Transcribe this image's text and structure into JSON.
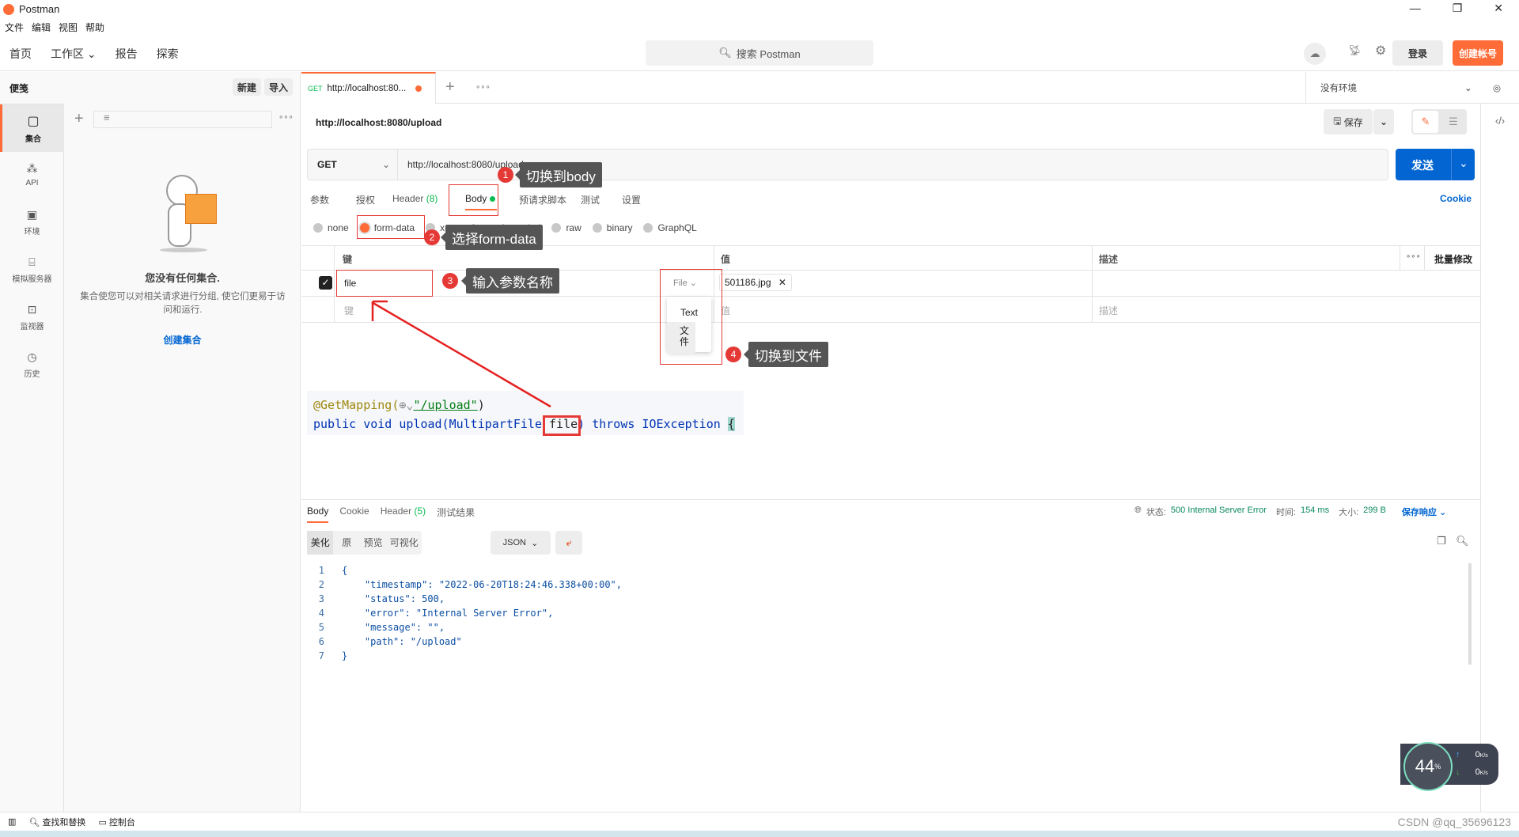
{
  "window": {
    "title": "Postman",
    "menu": [
      "文件",
      "编辑",
      "视图",
      "帮助"
    ]
  },
  "topnav": {
    "items": [
      "首页",
      "工作区",
      "报告",
      "探索"
    ],
    "search_placeholder": "搜索 Postman",
    "login": "登录",
    "signup": "创建帐号",
    "accent": "#ff6c37"
  },
  "sidebar": {
    "title": "便笺",
    "new": "新建",
    "import": "导入",
    "rail": [
      {
        "label": "集合",
        "icon": "collection-icon"
      },
      {
        "label": "API",
        "icon": "api-icon"
      },
      {
        "label": "环境",
        "icon": "environment-icon"
      },
      {
        "label": "模拟服务器",
        "icon": "mock-server-icon"
      },
      {
        "label": "监视器",
        "icon": "monitor-icon"
      },
      {
        "label": "历史",
        "icon": "history-icon"
      }
    ],
    "empty_title": "您没有任何集合.",
    "empty_desc": "集合使您可以对相关请求进行分组, 使它们更易于访问和运行.",
    "create": "创建集合"
  },
  "tab": {
    "method": "GET",
    "label": "http://localhost:80..."
  },
  "environment": "没有环境",
  "request": {
    "name": "http://localhost:8080/upload",
    "save": "保存",
    "method": "GET",
    "url": "http://localhost:8080/upload",
    "send": "发送",
    "cookie": "Cookie",
    "tabs": [
      "参数",
      "授权",
      "Header",
      "Body",
      "预请求脚本",
      "测试",
      "设置"
    ],
    "header_count": "(8)",
    "body_types": [
      "none",
      "form-data",
      "x-www-form-urlencoded",
      "raw",
      "binary",
      "GraphQL"
    ],
    "selected_body_type": "form-data",
    "table": {
      "headers": [
        "键",
        "值",
        "描述",
        "批量修改"
      ],
      "row": {
        "key": "file",
        "type": "File",
        "value": "501186.jpg",
        "checked": true
      },
      "placeholder": {
        "key": "键",
        "value": "值",
        "desc": "描述"
      }
    },
    "type_menu": [
      "Text",
      "文件"
    ]
  },
  "annotations": [
    {
      "n": "1",
      "text": "切换到body"
    },
    {
      "n": "2",
      "text": "选择form-data"
    },
    {
      "n": "3",
      "text": "输入参数名称"
    },
    {
      "n": "4",
      "text": "切换到文件"
    }
  ],
  "code": {
    "line1_a": "@GetMapping(",
    "line1_b": "\"/upload\"",
    "line1_c": ")",
    "line2": [
      "public void upload(MultipartFile ",
      "file",
      ") throws IOException ",
      "{"
    ]
  },
  "response": {
    "tabs": [
      "Body",
      "Cookie",
      "Header",
      "测试结果"
    ],
    "header_count": "(5)",
    "status_label": "状态:",
    "status": "500 Internal Server Error",
    "time_label": "时间:",
    "time": "154 ms",
    "size_label": "大小:",
    "size": "299 B",
    "save": "保存响应",
    "views": [
      "美化",
      "原",
      "预览",
      "可视化"
    ],
    "format": "JSON",
    "lines": [
      [
        "1",
        "{"
      ],
      [
        "2",
        "    \"timestamp\": \"2022-06-20T18:24:46.338+00:00\","
      ],
      [
        "3",
        "    \"status\": 500,"
      ],
      [
        "4",
        "    \"error\": \"Internal Server Error\","
      ],
      [
        "5",
        "    \"message\": \"\","
      ],
      [
        "6",
        "    \"path\": \"/upload\""
      ],
      [
        "7",
        "}"
      ]
    ]
  },
  "statusbar": {
    "find": "查找和替换",
    "console": "控制台",
    "watermark": "CSDN @qq_35696123"
  },
  "widget": {
    "cpu": "44",
    "unit": "%",
    "up": "0",
    "down": "0",
    "rate_unit": "K/s"
  }
}
